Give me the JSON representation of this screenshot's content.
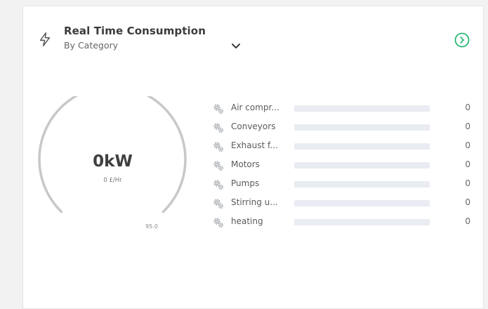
{
  "widget": {
    "title": "Real Time Consumption",
    "subtitle": "By Category",
    "header_icon": "lightning-bolt-icon",
    "dropdown_icon": "chevron-down-icon",
    "nav_icon": "chevron-right-circle-icon",
    "accent_color": "#2bb673"
  },
  "gauge": {
    "value_text": "0kW",
    "rate_text": "0 £/Hr",
    "max_label": "95.0",
    "level_fraction": 0
  },
  "categories": [
    {
      "label": "Air compr...",
      "value": "0",
      "fill_fraction": 0,
      "icon": "gears-icon"
    },
    {
      "label": "Conveyors",
      "value": "0",
      "fill_fraction": 0,
      "icon": "gears-icon"
    },
    {
      "label": "Exhaust f...",
      "value": "0",
      "fill_fraction": 0,
      "icon": "gears-icon"
    },
    {
      "label": "Motors",
      "value": "0",
      "fill_fraction": 0,
      "icon": "gears-icon"
    },
    {
      "label": "Pumps",
      "value": "0",
      "fill_fraction": 0,
      "icon": "gears-icon"
    },
    {
      "label": "Stirring u...",
      "value": "0",
      "fill_fraction": 0,
      "icon": "gears-icon"
    },
    {
      "label": "heating",
      "value": "0",
      "fill_fraction": 0,
      "icon": "gears-icon"
    }
  ]
}
